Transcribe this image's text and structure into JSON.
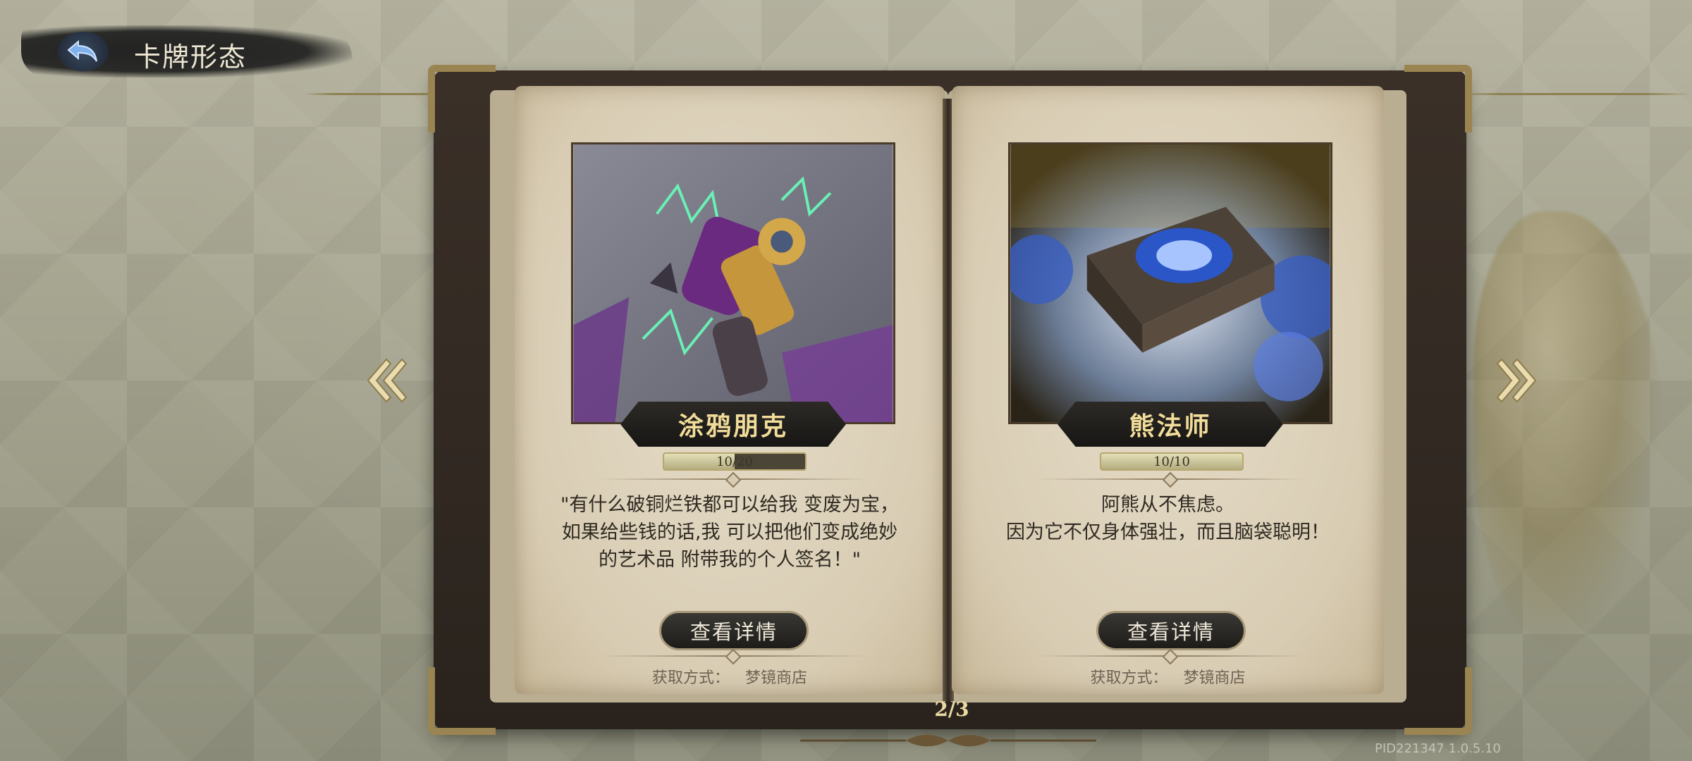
{
  "header": {
    "title": "卡牌形态",
    "back_icon": "back-arrow-icon"
  },
  "pager": {
    "text": "2/3"
  },
  "version_text": "PID221347  1.0.5.10",
  "cards": [
    {
      "name": "涂鸦朋克",
      "progress": {
        "current": 10,
        "max": 20,
        "text": "10/20"
      },
      "description": "\"有什么破铜烂铁都可以给我 变废为宝，如果给些钱的话,我 可以把他们变成绝妙的艺术品 附带我的个人签名！\"",
      "button_label": "查看详情",
      "source_label": "获取方式：",
      "source_value": "梦镜商店",
      "art_icon": "graffiti-drill-gun-icon"
    },
    {
      "name": "熊法师",
      "progress": {
        "current": 10,
        "max": 10,
        "text": "10/10"
      },
      "description": "阿熊从不焦虑。\n因为它不仅身体强壮，而且脑袋聪明！",
      "button_label": "查看详情",
      "source_label": "获取方式：",
      "source_value": "梦镜商店",
      "art_icon": "crystal-stone-book-icon"
    }
  ]
}
